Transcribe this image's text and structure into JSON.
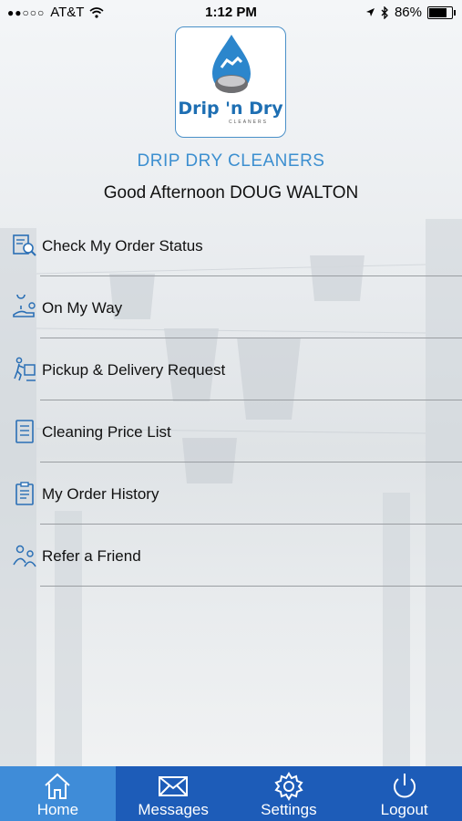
{
  "status_bar": {
    "signal": "●●○○○",
    "carrier": "AT&T",
    "time": "1:12 PM",
    "battery": "86%",
    "battery_level": 0.86
  },
  "logo": {
    "text": "Drip 'n Dry",
    "subtext": "CLEANERS"
  },
  "header": {
    "company_name": "DRIP DRY CLEANERS",
    "greeting": "Good Afternoon DOUG WALTON"
  },
  "menu": {
    "items": [
      {
        "label": "Check My Order Status",
        "icon": "order-status-icon"
      },
      {
        "label": "On My Way",
        "icon": "on-my-way-icon"
      },
      {
        "label": "Pickup & Delivery Request",
        "icon": "pickup-delivery-icon"
      },
      {
        "label": "Cleaning Price List",
        "icon": "price-list-icon"
      },
      {
        "label": "My Order History",
        "icon": "order-history-icon"
      },
      {
        "label": "Refer a Friend",
        "icon": "refer-friend-icon"
      }
    ]
  },
  "tab_bar": {
    "tabs": [
      {
        "label": "Home",
        "icon": "home-icon"
      },
      {
        "label": "Messages",
        "icon": "envelope-icon"
      },
      {
        "label": "Settings",
        "icon": "gear-icon"
      },
      {
        "label": "Logout",
        "icon": "power-icon"
      }
    ]
  },
  "colors": {
    "accent": "#3c8fd0",
    "tab_active": "#3f8cd8",
    "tab_inactive": "#1d5cb8",
    "icon_blue": "#2a6fb5"
  }
}
